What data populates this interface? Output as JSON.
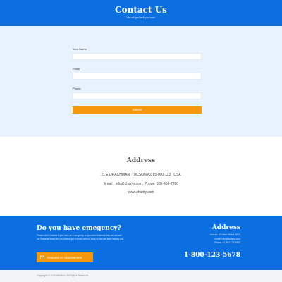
{
  "header": {
    "title": "Contact Us",
    "subtitle": "We will get back you soon"
  },
  "form": {
    "name_label": "Your Name",
    "email_label": "Email",
    "phone_label": "Phone",
    "submit_label": "Submit"
  },
  "address": {
    "title": "Address",
    "street": "21 E DRACHMAN, TUCSON AZ 85-000-123   USA",
    "contact": "Email : info@charity.com, Phone: 800-456-7890",
    "website": "www.charity.com"
  },
  "emergency": {
    "title": "Do you have emegency?",
    "text": "Please don't hesitate if you have an emergency or you need financial help we can sell our financial house for you please get in touch with us asap so we can start helping you.",
    "button_label": "Request an Appointment",
    "address_title": "Address",
    "address_lines": [
      "Adress: 2/2 Main Street, NYC",
      "Email: info@aodblia.com",
      "Phone: +1 804-123-4567"
    ],
    "phone": "1-800-123-5678"
  },
  "footer": {
    "copyright": "Copyright © 2019 Medbox. All Rights Reserved."
  },
  "colors": {
    "primary": "#0b6fe0",
    "accent": "#f5980c",
    "form_bg": "#e8f2fd"
  },
  "icons": {
    "appointment": "calendar-icon"
  }
}
